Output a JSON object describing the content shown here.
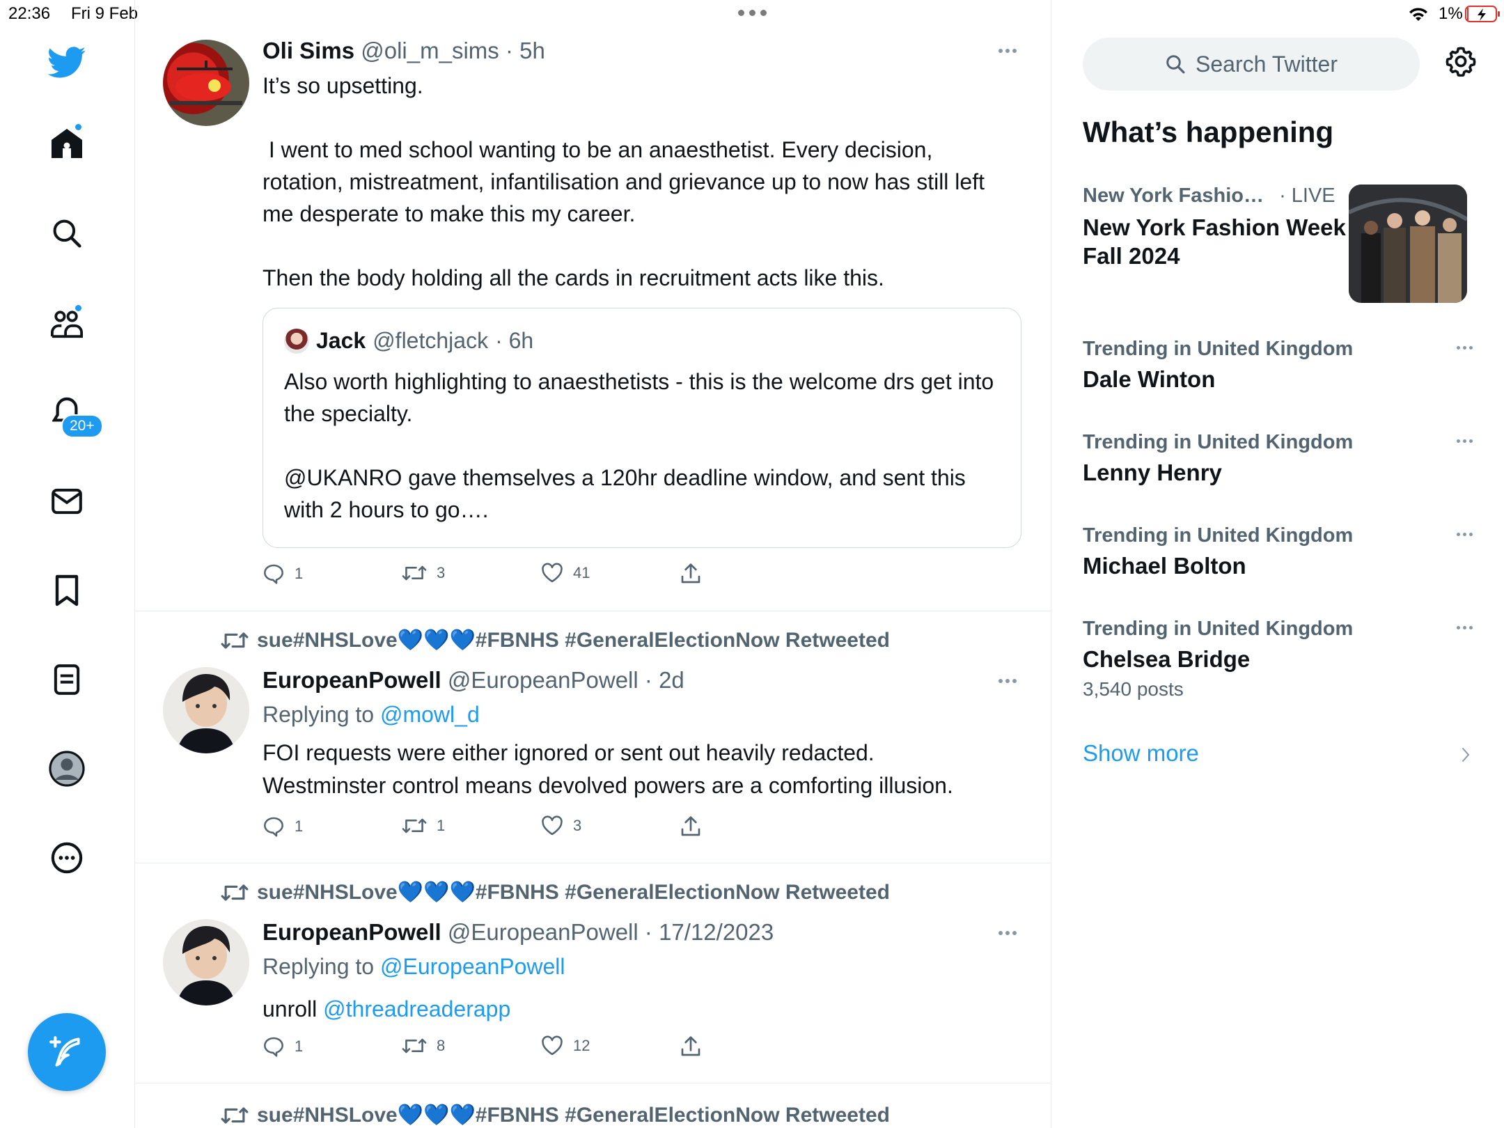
{
  "status_bar": {
    "time": "22:36",
    "date": "Fri 9 Feb",
    "battery": "1%"
  },
  "nav": {
    "items": [
      "Home",
      "Search",
      "Communities",
      "Notifications",
      "Messages",
      "Bookmarks",
      "Lists",
      "Profile",
      "More"
    ],
    "notifications_badge": "20+",
    "compose_label": "Post"
  },
  "tweets": [
    {
      "name": "Oli Sims",
      "handle": "@oli_m_sims",
      "time": "· 5h",
      "text": "It’s so upsetting.\n\n I went to med school wanting to be an anaesthetist. Every decision, rotation, mistreatment, infantilisation and grievance up to now has still left me desperate to make this my career.\n\nThen the body holding all the cards in recruitment acts like this.",
      "quote": {
        "name": "Jack",
        "handle": "@fletchjack",
        "time": "· 6h",
        "text": "Also worth highlighting to anaesthetists - this is the welcome drs get into the specialty.\n\n@UKANRO gave themselves a 120hr deadline window, and sent this with 2 hours to go…."
      },
      "replies": "1",
      "retweets": "3",
      "likes": "41"
    },
    {
      "retweeted_by": "sue#NHSLove💙💙💙#FBNHS #GeneralElectionNow Retweeted",
      "name": "EuropeanPowell",
      "handle": "@EuropeanPowell",
      "time": "· 2d",
      "replying_prefix": "Replying to",
      "replying_to": "@mowl_d",
      "text": "FOI requests were either ignored or sent out heavily redacted.\nWestminster control means devolved powers are a comforting illusion.",
      "replies": "1",
      "retweets": "1",
      "likes": "3"
    },
    {
      "retweeted_by": "sue#NHSLove💙💙💙#FBNHS #GeneralElectionNow Retweeted",
      "name": "EuropeanPowell",
      "handle": "@EuropeanPowell",
      "time": "· 17/12/2023",
      "replying_prefix": "Replying to",
      "replying_to": "@EuropeanPowell",
      "text_prefix": "unroll ",
      "text_link": "@threadreaderapp",
      "replies": "1",
      "retweets": "8",
      "likes": "12"
    },
    {
      "retweeted_by": "sue#NHSLove💙💙💙#FBNHS #GeneralElectionNow Retweeted"
    }
  ],
  "sidebar": {
    "search_placeholder": "Search Twitter",
    "heading": "What’s happening",
    "featured": {
      "category": "New York Fashio…",
      "live": "· LIVE",
      "title": "New York Fashion Week Fall 2024"
    },
    "trends": [
      {
        "category": "Trending in United Kingdom",
        "title": "Dale Winton"
      },
      {
        "category": "Trending in United Kingdom",
        "title": "Lenny Henry"
      },
      {
        "category": "Trending in United Kingdom",
        "title": "Michael Bolton"
      },
      {
        "category": "Trending in United Kingdom",
        "title": "Chelsea Bridge",
        "count": "3,540 posts"
      }
    ],
    "show_more": "Show more"
  },
  "colors": {
    "accent": "#1d9bf0",
    "text": "#0f1419",
    "secondary": "#536471",
    "border": "#e6ecf0"
  }
}
